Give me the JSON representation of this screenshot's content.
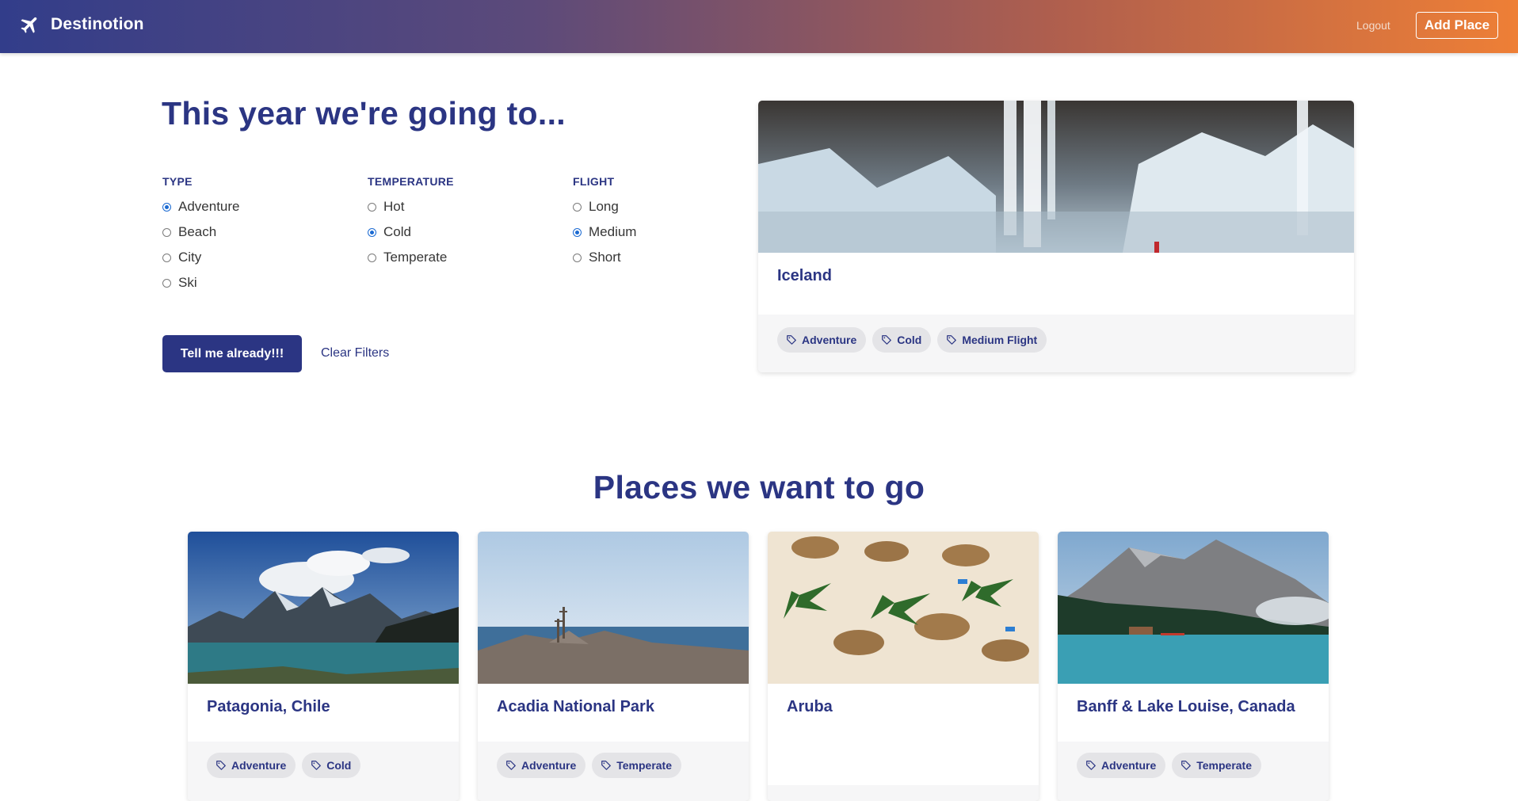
{
  "navbar": {
    "brand": "Destinotion",
    "logout_label": "Logout",
    "add_place_label": "Add Place"
  },
  "hero": {
    "title": "This year we're going to..."
  },
  "filters": {
    "type": {
      "label": "TYPE",
      "options": [
        "Adventure",
        "Beach",
        "City",
        "Ski"
      ],
      "selected": "Adventure"
    },
    "temperature": {
      "label": "TEMPERATURE",
      "options": [
        "Hot",
        "Cold",
        "Temperate"
      ],
      "selected": "Cold"
    },
    "flight": {
      "label": "FLIGHT",
      "options": [
        "Long",
        "Medium",
        "Short"
      ],
      "selected": "Medium"
    }
  },
  "actions": {
    "submit_label": "Tell me already!!!",
    "clear_label": "Clear Filters"
  },
  "result": {
    "name": "Iceland",
    "tags": [
      "Adventure",
      "Cold",
      "Medium Flight"
    ]
  },
  "places": {
    "title": "Places we want to go",
    "items": [
      {
        "name": "Patagonia, Chile",
        "tags": [
          "Adventure",
          "Cold"
        ]
      },
      {
        "name": "Acadia National Park",
        "tags": [
          "Adventure",
          "Temperate"
        ]
      },
      {
        "name": "Aruba",
        "tags": []
      },
      {
        "name": "Banff & Lake Louise, Canada",
        "tags": [
          "Adventure",
          "Temperate"
        ]
      }
    ]
  },
  "colors": {
    "primary": "#2b3583",
    "nav_gradient_start": "#323d8a",
    "nav_gradient_end": "#ee7f36",
    "radio_checked": "#1b6ad2",
    "tag_bg": "#e4e4e7"
  },
  "icons": {
    "brand": "airplane-icon",
    "tag": "tag-icon"
  }
}
